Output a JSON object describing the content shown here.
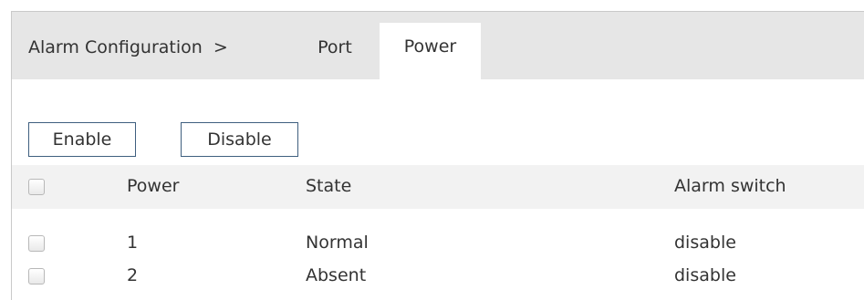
{
  "breadcrumb": {
    "title": "Alarm Configuration",
    "separator": ">"
  },
  "tabs": [
    {
      "label": "Port",
      "active": false
    },
    {
      "label": "Power",
      "active": true
    }
  ],
  "toolbar": {
    "enable_label": "Enable",
    "disable_label": "Disable"
  },
  "table": {
    "columns": [
      "Power",
      "State",
      "Alarm switch"
    ],
    "rows": [
      {
        "power": "1",
        "state": "Normal",
        "alarm_switch": "disable",
        "checked": false
      },
      {
        "power": "2",
        "state": "Absent",
        "alarm_switch": "disable",
        "checked": false
      }
    ]
  },
  "colors": {
    "tabbar_bg": "#e6e6e6",
    "header_bg": "#f2f2f2",
    "button_border": "#3f5f7f",
    "text": "#333333"
  }
}
